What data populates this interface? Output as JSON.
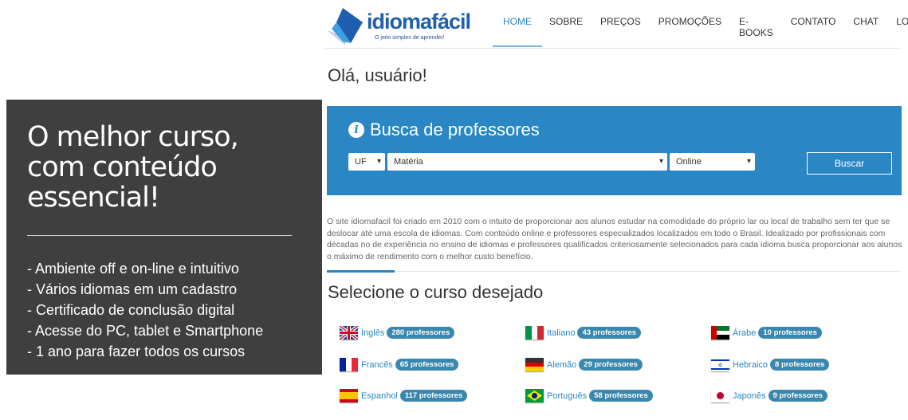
{
  "promo": {
    "title": "O melhor curso, com conteúdo essencial!",
    "items": [
      "- Ambiente off e on-line e intuitivo",
      "- Vários idiomas em um cadastro",
      "- Certificado de conclusão digital",
      "- Acesse do PC, tablet e Smartphone",
      "- 1 ano para fazer todos os cursos"
    ]
  },
  "logo": {
    "brand": "idiomafácil",
    "tagline": "O jeito simples de aprender!"
  },
  "nav": [
    "HOME",
    "SOBRE",
    "PREÇOS",
    "PROMOÇÕES",
    "E-BOOKS",
    "CONTATO",
    "CHAT",
    "LOGIN"
  ],
  "greeting": "Olá, usuário!",
  "search": {
    "title": "Busca de professores",
    "uf": "UF",
    "subject": "Matéria",
    "mode": "Online",
    "button": "Buscar"
  },
  "description": "O site idiomafacil foi criado em 2010 com o intuito de proporcionar aos alunos estudar na comodidade do próprio lar ou local de trabalho sem ter que se deslocar até uma escola de idiomas. Com conteúdo online e professores especializados localizados em todo o Brasil. Idealizado por profissionais com décadas no de experiência no ensino de idiomas e professores qualificados criteriosamente selecionados para cada idioma busca proporcionar aos alunos o máximo de rendimento com o melhor custo benefício.",
  "courses_title": "Selecione o curso desejado",
  "courses": [
    {
      "name": "Inglês",
      "count": "280 professores",
      "flag": "uk"
    },
    {
      "name": "Italiano",
      "count": "43 professores",
      "flag": "it"
    },
    {
      "name": "Árabe",
      "count": "10 professores",
      "flag": "ae"
    },
    {
      "name": "Francês",
      "count": "65 professores",
      "flag": "fr"
    },
    {
      "name": "Alemão",
      "count": "29 professores",
      "flag": "de"
    },
    {
      "name": "Hebraico",
      "count": "8 professores",
      "flag": "il"
    },
    {
      "name": "Espanhol",
      "count": "117 professores",
      "flag": "es"
    },
    {
      "name": "Português",
      "count": "58 professores",
      "flag": "br"
    },
    {
      "name": "Japonês",
      "count": "9 professores",
      "flag": "jp"
    }
  ],
  "colors": {
    "accent": "#2a87c4",
    "promo_bg": "#3f3f3f",
    "badge": "#3a87ad"
  }
}
